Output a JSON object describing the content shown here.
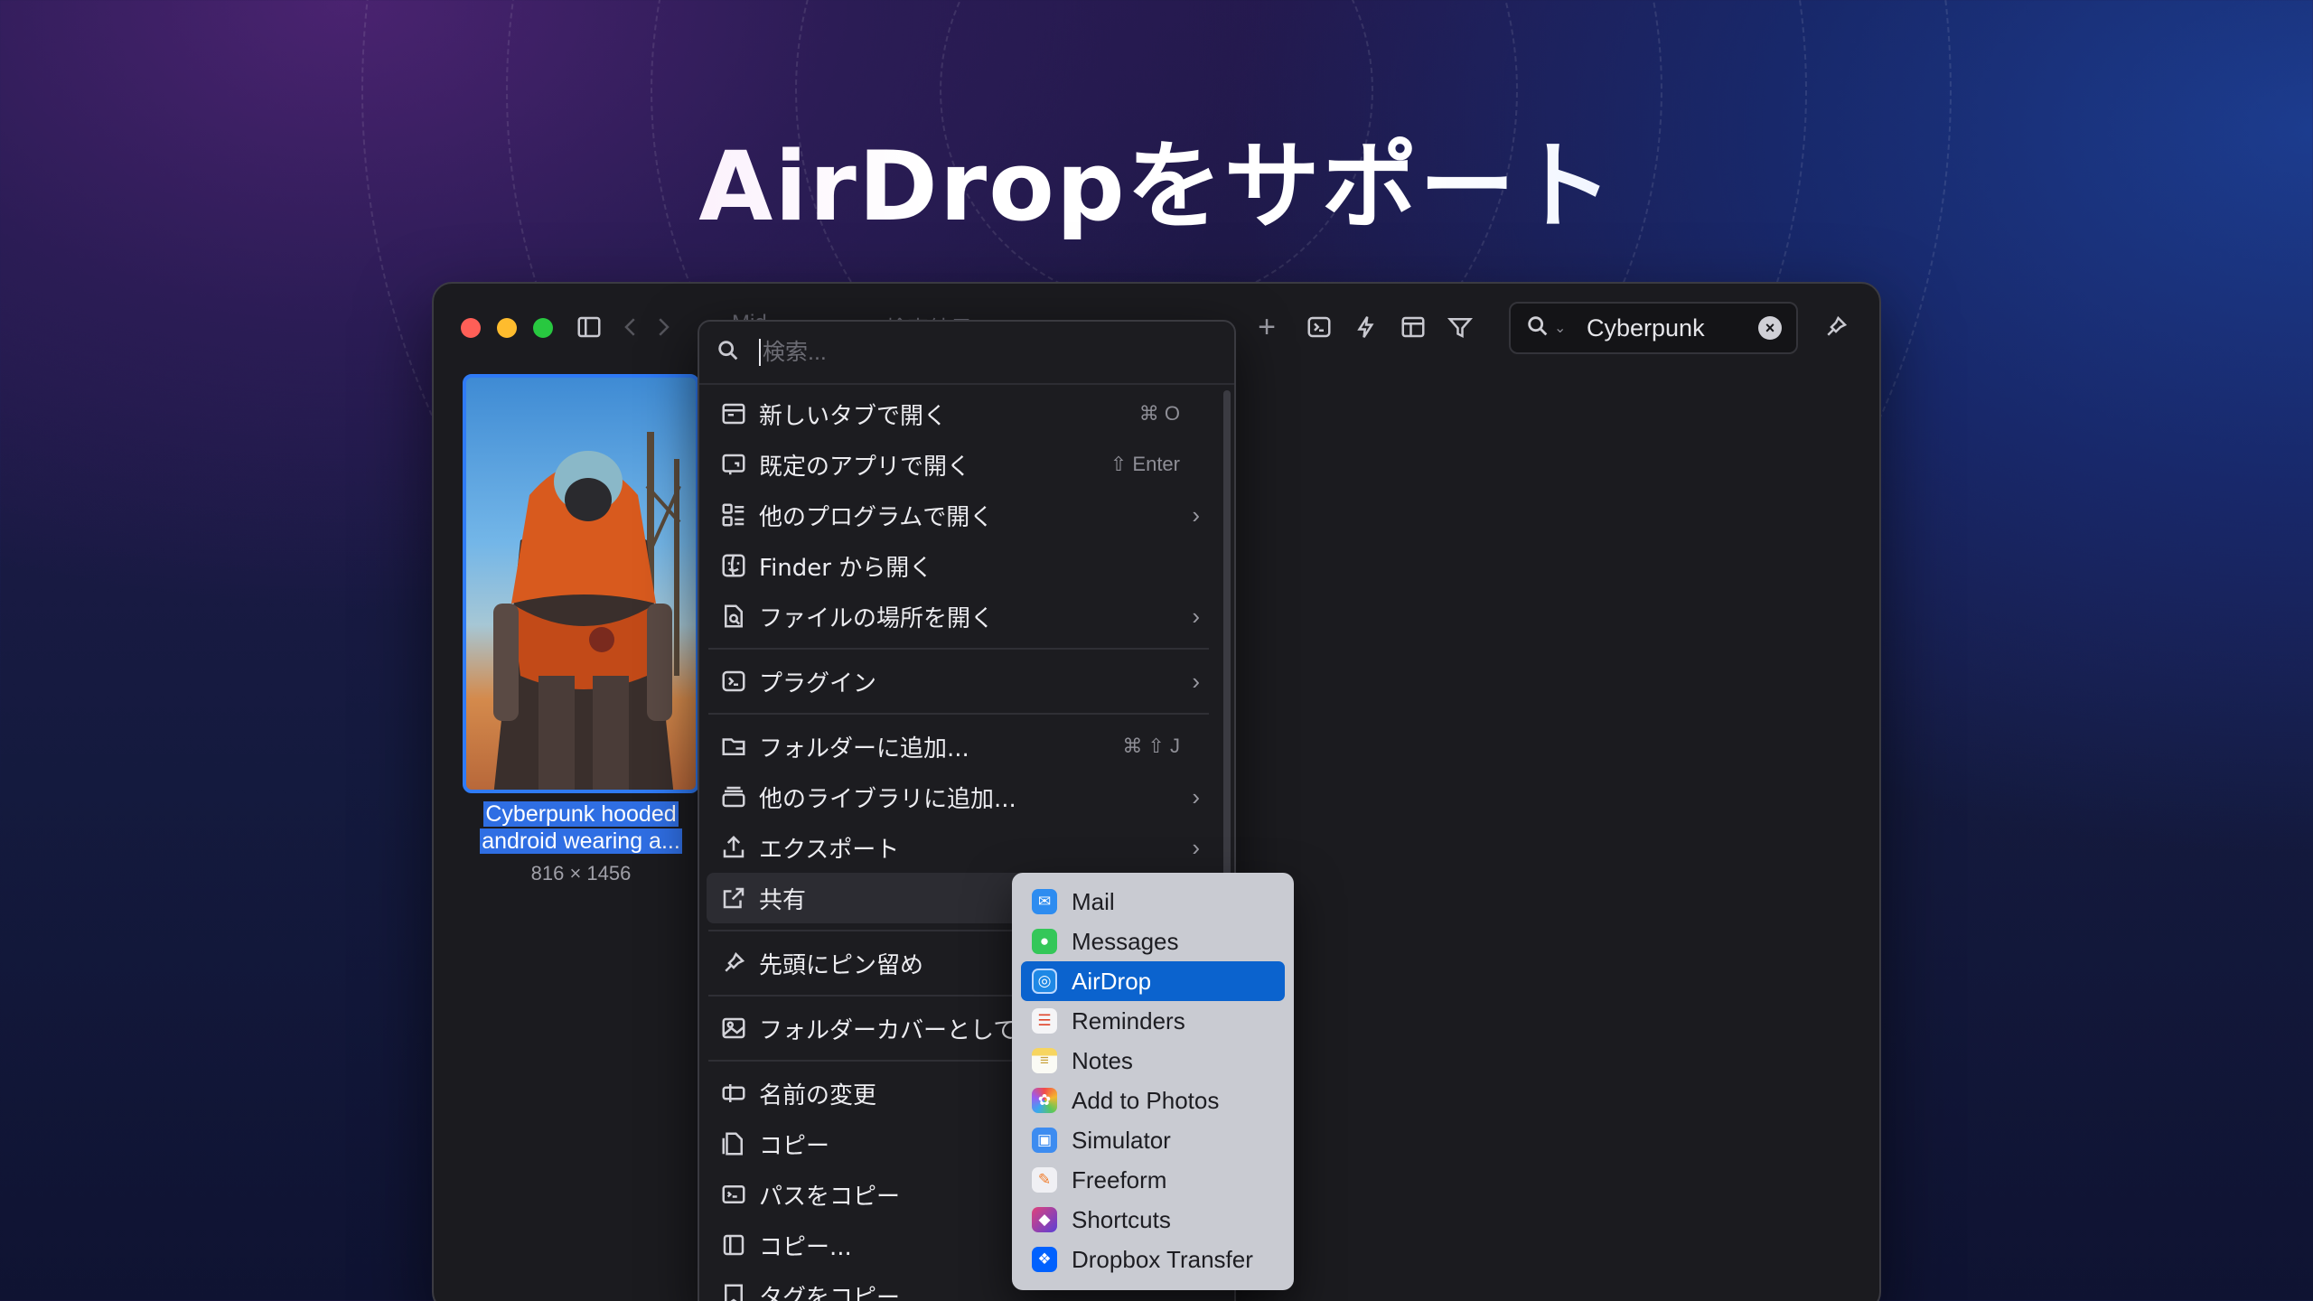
{
  "headline": "AirDropをサポート",
  "toolbar": {
    "ghost_tab_1": "Mid...",
    "ghost_tab_2": "検索結果 (1)",
    "search_value": "Cyberpunk",
    "clear_symbol": "×",
    "add_tab": "+"
  },
  "item": {
    "caption_line1": "Cyberpunk hooded",
    "caption_line2": "android wearing a...",
    "dimensions": "816 × 1456"
  },
  "menu": {
    "search_placeholder": "検索...",
    "items": [
      {
        "label": "新しいタブで開く",
        "shortcut": "⌘ O",
        "icon": "new-tab-icon"
      },
      {
        "label": "既定のアプリで開く",
        "shortcut": "⇧ Enter",
        "icon": "open-app-icon"
      },
      {
        "label": "他のプログラムで開く",
        "arrow": "›",
        "icon": "apps-grid-icon"
      },
      {
        "label": "Finder から開く",
        "icon": "finder-icon"
      },
      {
        "label": "ファイルの場所を開く",
        "arrow": "›",
        "icon": "file-search-icon"
      },
      {
        "label": "プラグイン",
        "arrow": "›",
        "icon": "terminal-icon"
      },
      {
        "label": "フォルダーに追加...",
        "shortcut": "⌘ ⇧ J",
        "icon": "folder-add-icon"
      },
      {
        "label": "他のライブラリに追加...",
        "arrow": "›",
        "icon": "library-icon"
      },
      {
        "label": "エクスポート",
        "arrow": "›",
        "icon": "export-icon"
      },
      {
        "label": "共有",
        "icon": "share-icon"
      },
      {
        "label": "先頭にピン留め",
        "icon": "pin-icon"
      },
      {
        "label": "フォルダーカバーとして",
        "icon": "image-icon"
      },
      {
        "label": "名前の変更",
        "icon": "rename-icon"
      },
      {
        "label": "コピー",
        "icon": "copy-icon"
      },
      {
        "label": "パスをコピー",
        "icon": "path-icon"
      },
      {
        "label": "コピー...",
        "icon": "copy-more-icon"
      },
      {
        "label": "タグをコピー",
        "icon": "tag-icon"
      }
    ]
  },
  "share_menu": {
    "items": [
      {
        "name": "Mail",
        "color": "#2d8cf0"
      },
      {
        "name": "Messages",
        "color": "#34c759"
      },
      {
        "name": "AirDrop",
        "color": "#1e88e5"
      },
      {
        "name": "Reminders",
        "color": "#f5f5f7"
      },
      {
        "name": "Notes",
        "color": "#f7d560"
      },
      {
        "name": "Add to Photos",
        "color": "#e8e8ee"
      },
      {
        "name": "Simulator",
        "color": "#3d8cf0"
      },
      {
        "name": "Freeform",
        "color": "#f0f0f4"
      },
      {
        "name": "Shortcuts",
        "color": "#5b3fd6"
      },
      {
        "name": "Dropbox Transfer",
        "color": "#0061fe"
      }
    ]
  },
  "colors": {
    "accent": "#2f7bf6",
    "selection": "#0b63ce"
  }
}
